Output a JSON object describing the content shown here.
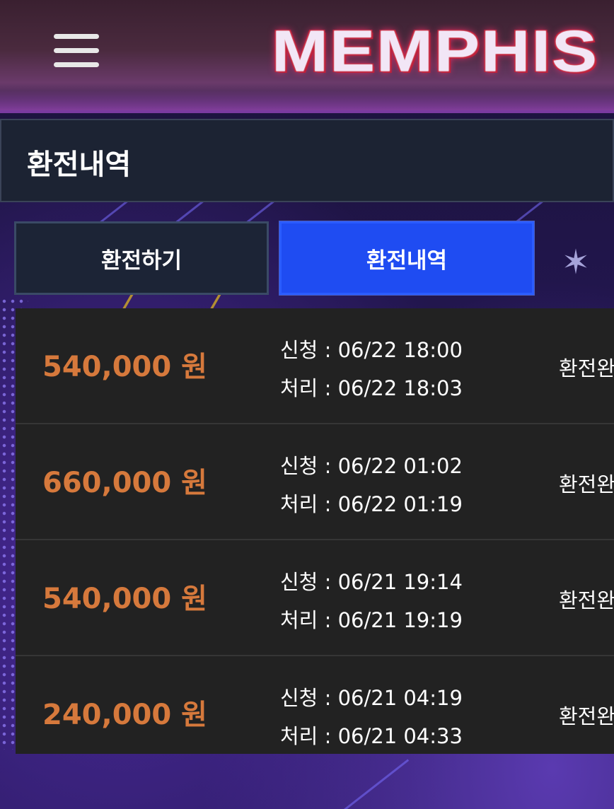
{
  "header": {
    "logo_text": "MEMPHIS",
    "menu_icon": "hamburger-menu-icon"
  },
  "page": {
    "title": "환전내역"
  },
  "tabs": [
    {
      "label": "환전하기",
      "active": false
    },
    {
      "label": "환전내역",
      "active": true
    }
  ],
  "history": [
    {
      "amount": "540,000 원",
      "requested": "신청 : 06/22 18:00",
      "processed": "처리 : 06/22 18:03",
      "status": "환전완료"
    },
    {
      "amount": "660,000 원",
      "requested": "신청 : 06/22 01:02",
      "processed": "처리 : 06/22 01:19",
      "status": "환전완료"
    },
    {
      "amount": "540,000 원",
      "requested": "신청 : 06/21 19:14",
      "processed": "처리 : 06/21 19:19",
      "status": "환전완료"
    },
    {
      "amount": "240,000 원",
      "requested": "신청 : 06/21 04:19",
      "processed": "처리 : 06/21 04:33",
      "status": "환전완료"
    }
  ],
  "colors": {
    "accent_active_tab": "#1f4cf2",
    "amount": "#d6793c",
    "list_background": "#222222"
  }
}
